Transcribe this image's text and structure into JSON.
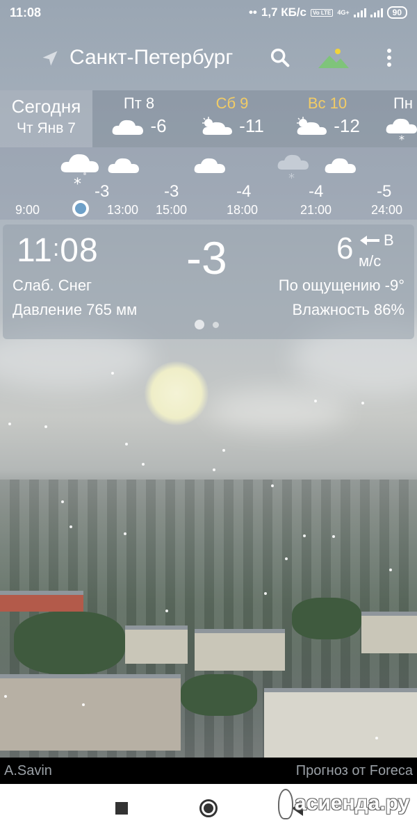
{
  "statusbar": {
    "time": "11:08",
    "speed": "1,7 КБ/с",
    "network": "4G+",
    "volte": "Vo LTE",
    "battery": "90"
  },
  "header": {
    "city": "Санкт-Петербург"
  },
  "daily": {
    "today_label": "Сегодня",
    "today_date": "Чт Янв 7",
    "days": [
      {
        "name": "Пт 8",
        "temp": "-6",
        "icon": "cloud-icon",
        "weekend": false
      },
      {
        "name": "Сб 9",
        "temp": "-11",
        "icon": "partly-cloudy-icon",
        "weekend": true
      },
      {
        "name": "Вс 10",
        "temp": "-12",
        "icon": "partly-cloudy-icon",
        "weekend": true
      },
      {
        "name": "Пн",
        "temp": "",
        "icon": "snow-cloud-icon",
        "weekend": false
      }
    ]
  },
  "hourly": {
    "temps": [
      "-3",
      "-3",
      "-4",
      "-4",
      "-5"
    ],
    "times": [
      "9:00",
      "13:00",
      "15:00",
      "18:00",
      "21:00",
      "24:00"
    ]
  },
  "current": {
    "time_h": "11",
    "time_m": "08",
    "temp": "-3",
    "wind_speed": "6",
    "wind_dir": "В",
    "wind_unit": "м/с",
    "condition": "Слаб. Снег",
    "feels_like": "По ощущению -9°",
    "pressure": "Давление 765 мм",
    "humidity": "Влажность 86%"
  },
  "footer": {
    "author": "A.Savin",
    "provider": "Прогноз от Foreca"
  },
  "watermark": "асиенда.ру",
  "colors": {
    "weekend": "#f2cc66",
    "now_marker": "#6ea0c8"
  }
}
